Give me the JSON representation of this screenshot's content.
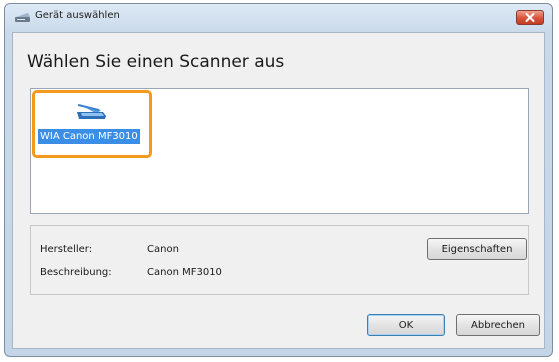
{
  "window": {
    "title": "Gerät auswählen"
  },
  "heading": "Wählen Sie einen Scanner aus",
  "devices": [
    {
      "label": "WIA Canon MF3010",
      "icon": "scanner-icon",
      "selected": true
    }
  ],
  "info": {
    "manufacturer_label": "Hersteller:",
    "manufacturer_value": "Canon",
    "description_label": "Beschreibung:",
    "description_value": "Canon MF3010",
    "properties_button": "Eigenschaften"
  },
  "buttons": {
    "ok": "OK",
    "cancel": "Abbrechen"
  },
  "colors": {
    "selection_border": "#f39a1c",
    "selection_highlight": "#3a8ee6",
    "close_button": "#d9533a"
  }
}
